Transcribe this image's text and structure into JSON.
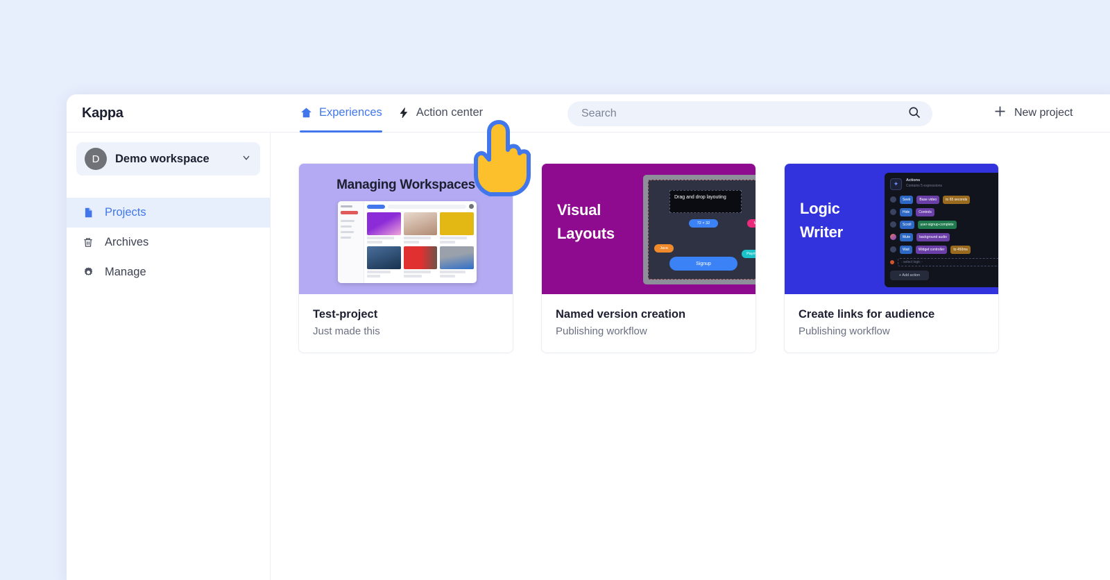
{
  "window": {
    "brand": "Kappa"
  },
  "header": {
    "tabs": [
      {
        "label": "Experiences",
        "icon": "home-icon",
        "active": true
      },
      {
        "label": "Action center",
        "icon": "lightning-icon",
        "active": false
      }
    ],
    "search": {
      "placeholder": "Search",
      "value": "",
      "icon": "search-icon"
    },
    "new_project": {
      "label": "New project",
      "icon": "plus-icon"
    }
  },
  "sidebar": {
    "workspace": {
      "avatar_letter": "D",
      "name": "Demo workspace",
      "chevron": "chevron-down-icon"
    },
    "items": [
      {
        "label": "Projects",
        "icon": "document-icon",
        "active": true
      },
      {
        "label": "Archives",
        "icon": "trash-icon",
        "active": false
      },
      {
        "label": "Manage",
        "icon": "gear-icon",
        "active": false
      }
    ]
  },
  "main": {
    "cards": [
      {
        "title": "Test-project",
        "subtitle": "Just made this",
        "thumb_heading": "Managing Workspaces",
        "thumb_style": "workspace-gallery",
        "accent": "#b4aaf4"
      },
      {
        "title": "Named version creation",
        "subtitle": "Publishing workflow",
        "thumb_heading": "Visual Layouts",
        "thumb_style": "layout-editor",
        "accent": "#8e0a8e",
        "editor": {
          "note": "Drag and drop layouting",
          "chips": [
            "72 × 32",
            "Minimal",
            "Java",
            "Payment"
          ],
          "button": "Signup"
        }
      },
      {
        "title": "Create links for audience",
        "subtitle": "Publishing workflow",
        "thumb_heading": "Logic Writer",
        "thumb_style": "action-list",
        "accent": "#3333dd",
        "panel": {
          "heading": "Actions",
          "subheading": "Contains 5 expressions",
          "rows": [
            {
              "verb": "Seek",
              "target": "Base video",
              "value": "to 65 seconds"
            },
            {
              "verb": "Hide",
              "target": "Controls",
              "value": ""
            },
            {
              "verb": "Scroll",
              "target": "user-signup-complete",
              "value": ""
            },
            {
              "verb": "Mute",
              "target": "background audio",
              "value": ""
            },
            {
              "verb": "Wait",
              "target": "Widget controller",
              "value": "to 450ms"
            }
          ],
          "select_placeholder": "- select logic -",
          "add_label": "+ Add action"
        }
      }
    ]
  },
  "cursor": {
    "type": "pointing-hand-cursor",
    "fill": "#fcc02c",
    "stroke": "#4277ec"
  },
  "colors": {
    "page_background": "#e7eefc",
    "accent_blue": "#4277ec",
    "active_nav_background": "#e7eefc",
    "search_background": "#eef2fa",
    "text_primary": "#1b1f30",
    "text_secondary": "#6a7082"
  }
}
